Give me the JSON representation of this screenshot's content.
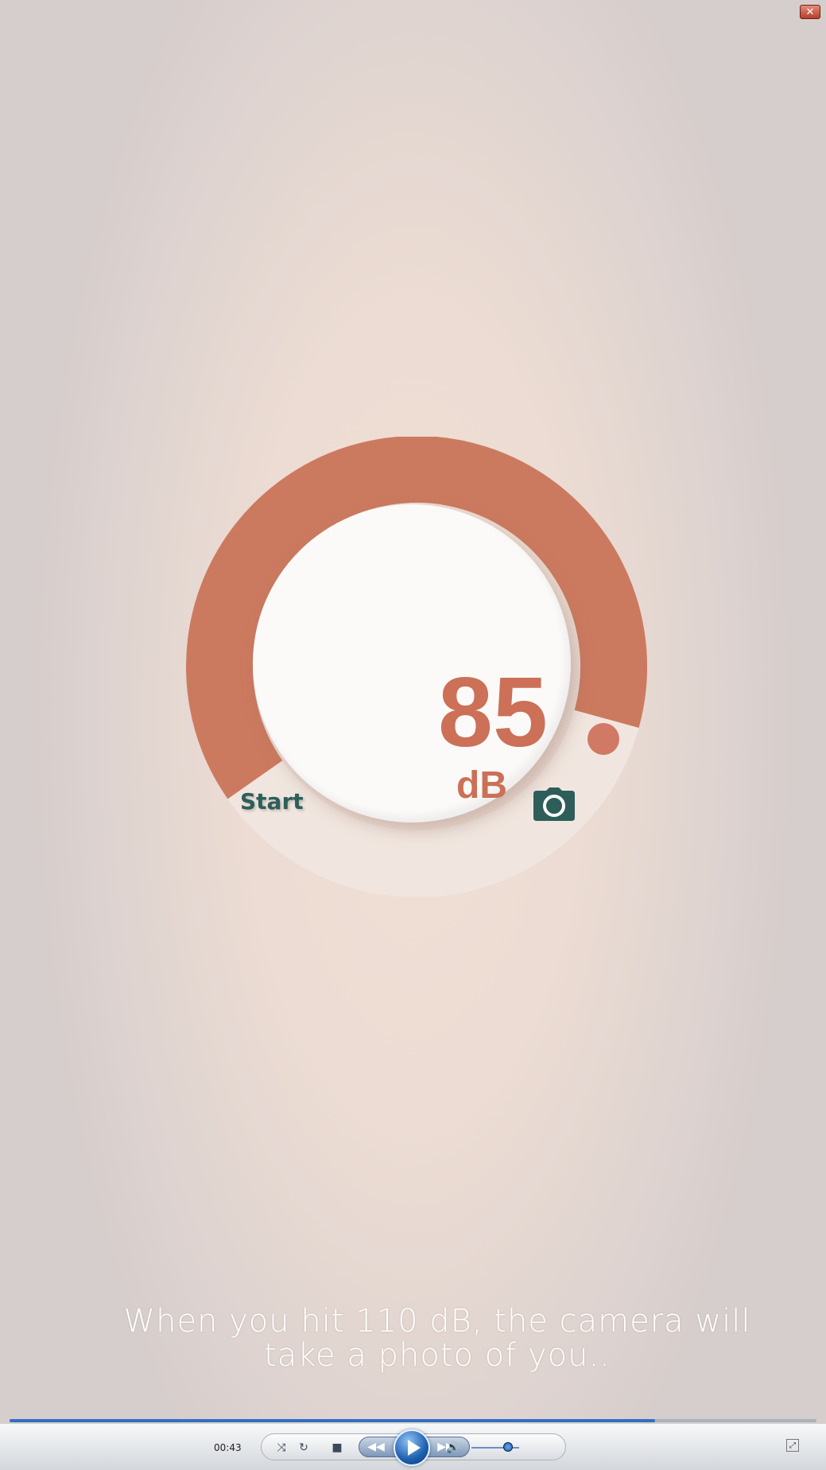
{
  "meter": {
    "value": "85",
    "unit": "dB",
    "level_fraction": 0.64,
    "arc_color": "#cc7a5f",
    "track_color": "#f1e6df",
    "start_label": "Start",
    "camera_icon": "camera-icon",
    "accent_color": "#2e5e5a"
  },
  "subtitle": {
    "line1": "When you hit 110 dB, the camera will",
    "line2": "take a photo of you.."
  },
  "player": {
    "time": "00:43",
    "progress_fraction": 0.8,
    "volume_fraction": 0.75
  }
}
